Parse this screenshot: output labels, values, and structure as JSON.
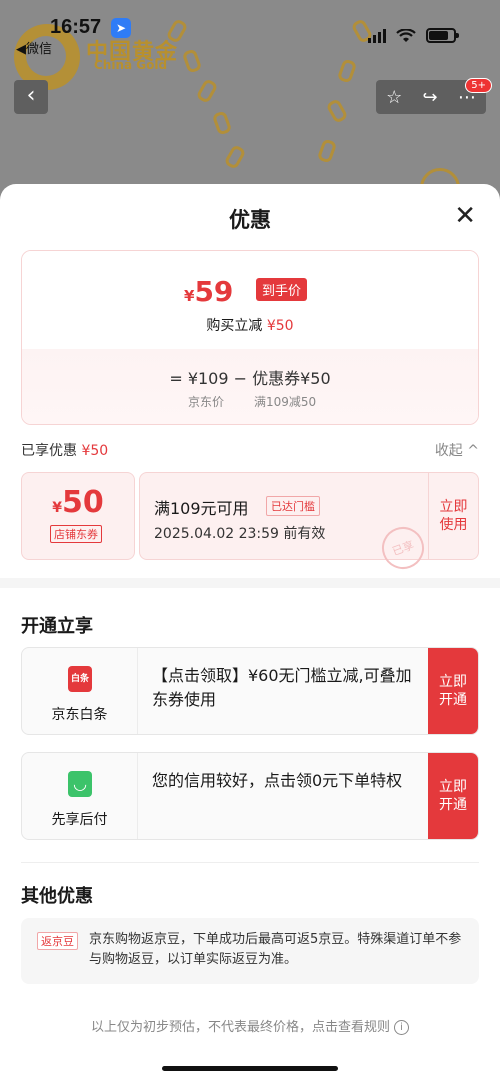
{
  "status": {
    "time": "16:57",
    "back_app": "◀微信"
  },
  "brand": {
    "name_cn": "中国黄金",
    "name_en": "China Gold"
  },
  "header_badge": "5+",
  "sheet": {
    "title": "优惠",
    "price_card": {
      "currency": "¥",
      "final_price": "59",
      "final_tag": "到手价",
      "instant_label": "购买立减",
      "instant_amount": "¥50",
      "formula_eq": "=",
      "original_price": "¥109",
      "formula_minus": "−",
      "coupon_text": "优惠券¥50",
      "original_label": "京东价",
      "coupon_rule": "满109减50"
    },
    "enjoyed": {
      "label": "已享优惠",
      "amount": "¥50",
      "collapse": "收起 ^"
    },
    "coupon": {
      "currency": "¥",
      "amount": "50",
      "type": "店铺东券",
      "condition": "满109元可用",
      "reached": "已达门槛",
      "expiry": "2025.04.02 23:59 前有效",
      "stamp": "已享",
      "action": "立即使用"
    },
    "open_section": {
      "title": "开通立享",
      "items": [
        {
          "icon_text": "白条",
          "label": "京东白条",
          "text": "【点击领取】¥60无门槛立减,可叠加东券使用",
          "action": "立即开通"
        },
        {
          "icon_text": "◡",
          "label": "先享后付",
          "text": "您的信用较好，点击领0元下单特权",
          "action": "立即开通"
        }
      ]
    },
    "other_section": {
      "title": "其他优惠",
      "tag": "返京豆",
      "text": "京东购物返京豆，下单成功后最高可返5京豆。特殊渠道订单不参与购物返豆，以订单实际返豆为准。"
    },
    "footnote": "以上仅为初步预估，不代表最终价格，点击查看规则"
  },
  "colors": {
    "accent": "#e4393c",
    "baitiao_icon": "#e4393c",
    "xianxiang_icon": "#3cc36a"
  }
}
